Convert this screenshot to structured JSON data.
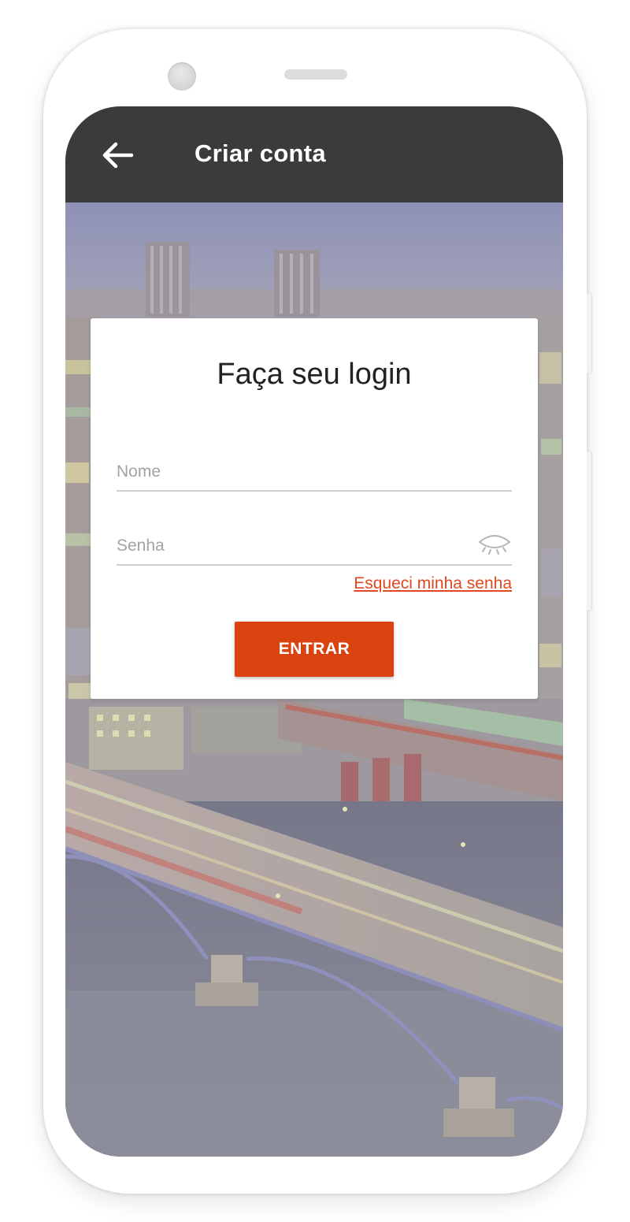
{
  "appbar": {
    "title": "Criar conta",
    "back_icon": "arrow-left-icon"
  },
  "login_card": {
    "title": "Faça seu login",
    "name_field": {
      "placeholder": "Nome",
      "value": ""
    },
    "password_field": {
      "placeholder": "Senha",
      "value": "",
      "toggle_icon": "eye-closed-icon"
    },
    "forgot_link": "Esqueci minha senha",
    "submit_label": "ENTRAR"
  },
  "background": {
    "image": "city-bridge-aerial-photo"
  },
  "colors": {
    "appbar": "#3b3b3b",
    "accent": "#d8430f",
    "link": "#e0481f",
    "card": "#ffffff"
  }
}
